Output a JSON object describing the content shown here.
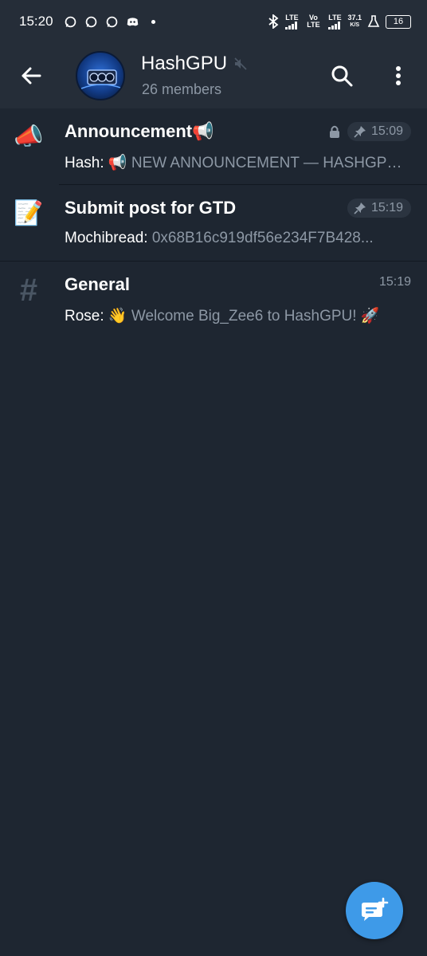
{
  "status_bar": {
    "time": "15:20",
    "net_speed_value": "37.1",
    "net_speed_unit": "K/S",
    "battery": "16",
    "lte1": "LTE",
    "volte": "Vo LTE",
    "lte2": "LTE"
  },
  "header": {
    "title": "HashGPU",
    "subtitle": "26 members",
    "muted_icon": "muted-speaker-icon"
  },
  "topics": [
    {
      "icon": "📣",
      "title": "Announcement📢",
      "sender": "Hash: ",
      "preview": "📢 NEW ANNOUNCEMENT — HASHGPU...",
      "locked": true,
      "pinned": true,
      "time": "15:09"
    },
    {
      "icon": "📝",
      "title": "Submit post for GTD",
      "sender": "Mochibread: ",
      "preview": "0x68B16c919df56e234F7B428...",
      "locked": false,
      "pinned": true,
      "time": "15:19"
    },
    {
      "icon": "#",
      "title": "General",
      "sender": "Rose: ",
      "preview": "👋 Welcome Big_Zee6 to HashGPU! 🚀",
      "locked": false,
      "pinned": false,
      "time": "15:19"
    }
  ],
  "colors": {
    "background": "#1e2631",
    "header": "#252d38",
    "secondary_text": "#8d98a5",
    "accent": "#3e9ae8"
  }
}
